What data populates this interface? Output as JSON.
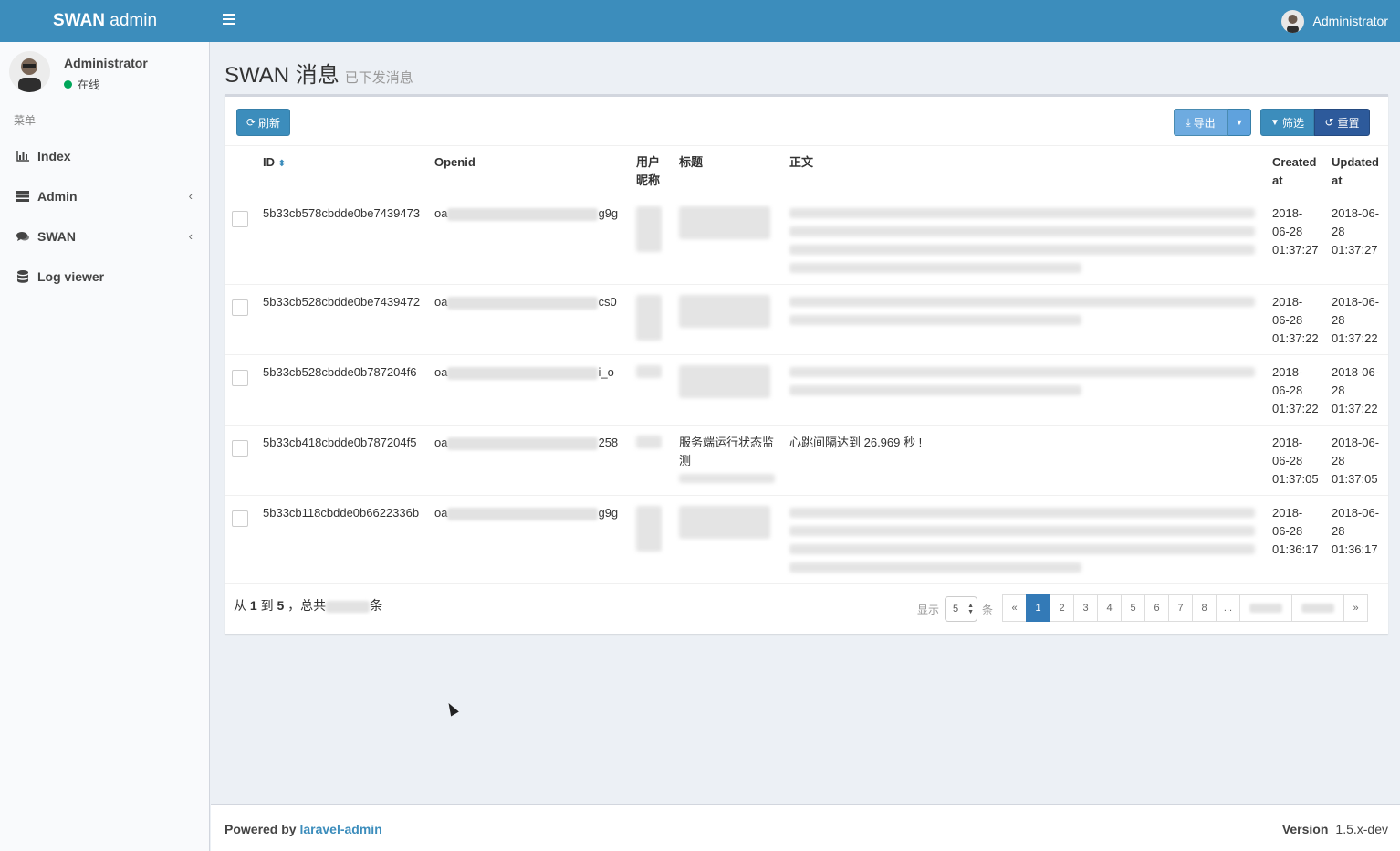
{
  "app": {
    "logo_bold": "SWAN",
    "logo_light": "admin"
  },
  "header": {
    "user_name": "Administrator"
  },
  "sidebar": {
    "user_name": "Administrator",
    "status": "在线",
    "menu_header": "菜单",
    "items": [
      {
        "label": "Index",
        "icon": "bar-chart-icon",
        "has_children": false
      },
      {
        "label": "Admin",
        "icon": "tasks-icon",
        "has_children": true
      },
      {
        "label": "SWAN",
        "icon": "comments-icon",
        "has_children": true
      },
      {
        "label": "Log viewer",
        "icon": "database-icon",
        "has_children": false
      }
    ]
  },
  "page": {
    "title": "SWAN 消息",
    "subtitle": "已下发消息"
  },
  "toolbar": {
    "refresh": "刷新",
    "export": "导出",
    "filter": "筛选",
    "reset": "重置"
  },
  "table": {
    "headers": {
      "id": "ID",
      "openid": "Openid",
      "nickname_1": "用户",
      "nickname_2": "昵称",
      "title": "标题",
      "body": "正文",
      "created_1": "Created",
      "created_2": "at",
      "updated_1": "Updated",
      "updated_2": "at"
    },
    "rows": [
      {
        "id": "5b33cb578cbdde0be7439473",
        "openid_pre": "oa",
        "openid_suf": "g9g",
        "title": "",
        "title_sub": "",
        "body": "",
        "created": [
          "2018-",
          "06-28",
          "01:37:27"
        ],
        "updated": [
          "2018-06-",
          "28",
          "01:37:27"
        ]
      },
      {
        "id": "5b33cb528cbdde0be7439472",
        "openid_pre": "oa",
        "openid_suf": "cs0",
        "title": "",
        "title_sub": "",
        "body": "",
        "created": [
          "2018-",
          "06-28",
          "01:37:22"
        ],
        "updated": [
          "2018-06-",
          "28",
          "01:37:22"
        ]
      },
      {
        "id": "5b33cb528cbdde0b787204f6",
        "openid_pre": "oa",
        "openid_suf": "i_o",
        "title": "",
        "title_sub": "",
        "body": "",
        "created": [
          "2018-",
          "06-28",
          "01:37:22"
        ],
        "updated": [
          "2018-06-",
          "28",
          "01:37:22"
        ]
      },
      {
        "id": "5b33cb418cbdde0b787204f5",
        "openid_pre": "oa",
        "openid_suf": "258",
        "title": "服务端运行状态监测",
        "title_sub": "",
        "body": "心跳间隔达到 26.969 秒 !",
        "created": [
          "2018-",
          "06-28",
          "01:37:05"
        ],
        "updated": [
          "2018-06-",
          "28",
          "01:37:05"
        ]
      },
      {
        "id": "5b33cb118cbdde0b6622336b",
        "openid_pre": "oa",
        "openid_suf": "g9g",
        "title": "",
        "title_sub": "",
        "body": "",
        "created": [
          "2018-",
          "06-28",
          "01:36:17"
        ],
        "updated": [
          "2018-06-",
          "28",
          "01:36:17"
        ]
      }
    ]
  },
  "footer_info": {
    "prefix": "从",
    "from": "1",
    "mid": "到",
    "to": "5",
    "total_prefix": "，总共",
    "suffix": "条"
  },
  "pagination": {
    "show_label": "显示",
    "per_page": "5",
    "unit": "条",
    "prev": "«",
    "next": "»",
    "pages": [
      "1",
      "2",
      "3",
      "4",
      "5",
      "6",
      "7",
      "8",
      "..."
    ],
    "active": "1"
  },
  "footer": {
    "powered": "Powered by",
    "link": "laravel-admin",
    "version_label": "Version",
    "version": "1.5.x-dev"
  },
  "colors": {
    "brand": "#3c8dbc",
    "active_page": "#337ab7",
    "online": "#00a65a"
  }
}
